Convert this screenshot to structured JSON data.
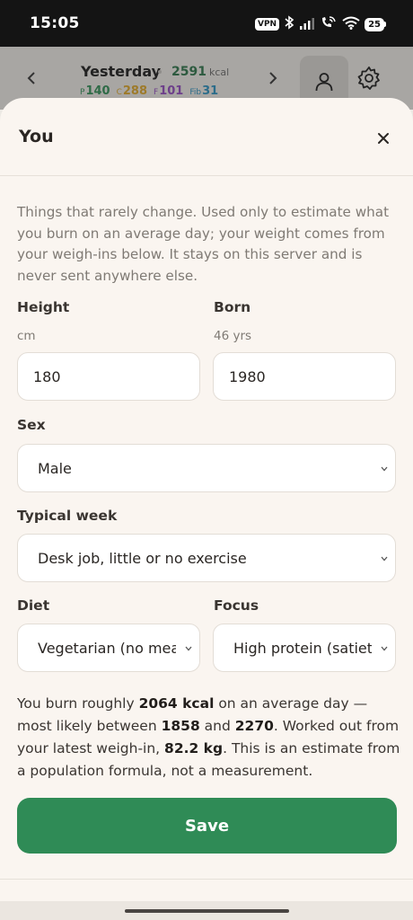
{
  "status_bar": {
    "time": "15:05",
    "vpn": "VPN",
    "battery": "25"
  },
  "app_header": {
    "day": "Yesterday",
    "kcal_value": "2591",
    "kcal_unit": "kcal",
    "macros": [
      {
        "label": "P",
        "value": "140"
      },
      {
        "label": "C",
        "value": "288"
      },
      {
        "label": "F",
        "value": "101"
      },
      {
        "label": "Fib",
        "value": "31"
      }
    ]
  },
  "sheet": {
    "title": "You",
    "intro": "Things that rarely change. Used only to estimate what you burn on an average day; your weight comes from your weigh-ins below. It stays on this server and is never sent anywhere else.",
    "height": {
      "label": "Height",
      "unit": "cm",
      "value": "180"
    },
    "born": {
      "label": "Born",
      "age": "46 yrs",
      "value": "1980"
    },
    "sex": {
      "label": "Sex",
      "value": "Male"
    },
    "typical_week": {
      "label": "Typical week",
      "value": "Desk job, little or no exercise"
    },
    "diet": {
      "label": "Diet",
      "value": "Vegetarian (no meat)"
    },
    "focus": {
      "label": "Focus",
      "value": "High protein (satiety)"
    },
    "summary": {
      "t1": "You burn roughly ",
      "kcal": "2064 kcal",
      "t2": " on an average day — most likely between ",
      "low": "1858",
      "t3": " and ",
      "high": "2270",
      "t4": ". Worked out from your latest weigh-in, ",
      "weight": "82.2 kg",
      "t5": ". This is an estimate from a population formula, not a measurement."
    },
    "save_label": "Save"
  }
}
